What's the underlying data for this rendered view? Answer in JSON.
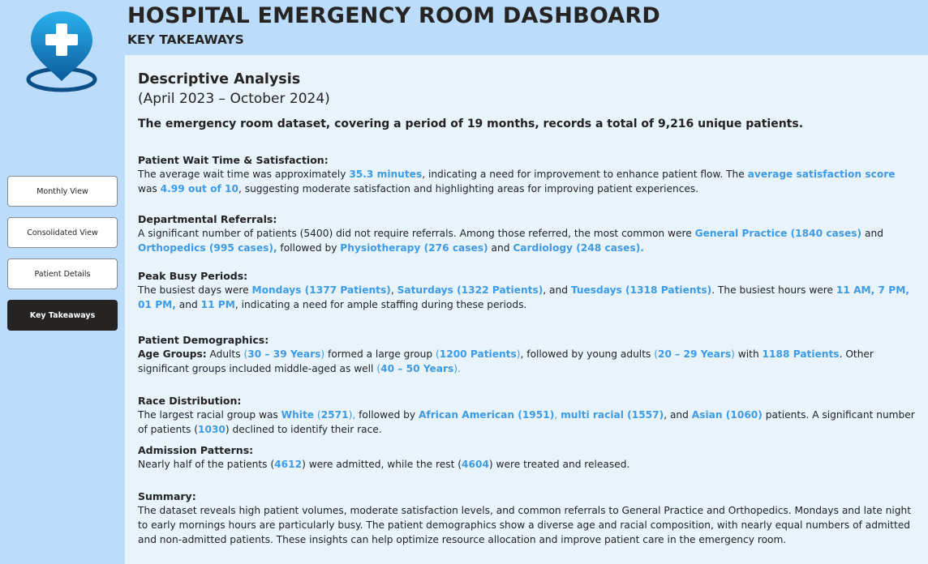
{
  "header": {
    "title": "HOSPITAL EMERGENCY ROOM DASHBOARD",
    "subtitle": "KEY TAKEAWAYS"
  },
  "logo": {
    "icon": "hospital-location-pin-icon",
    "colors": [
      "#1d9fe0",
      "#0a4f88"
    ]
  },
  "sidebar": {
    "items": [
      {
        "label": "Monthly View",
        "active": false
      },
      {
        "label": "Consolidated View",
        "active": false
      },
      {
        "label": "Patient Details",
        "active": false
      },
      {
        "label": "Key Takeaways",
        "active": true
      }
    ]
  },
  "colors": {
    "accent": "#3d9be9",
    "active_button": "#252423",
    "panel": "#e8f3fc",
    "background": "#bcdcfb"
  },
  "content": {
    "title": "Descriptive Analysis",
    "period": "(April 2023 – October 2024)",
    "lead": "The emergency room dataset, covering a period of 19 months, records a total of 9,216 unique patients.",
    "wait": {
      "heading": "Patient Wait Time & Satisfaction:",
      "t1": "The average wait time was approximately ",
      "h1": "35.3 minutes",
      "t2": ", indicating a need for improvement to enhance patient flow. The ",
      "h2": "average satisfaction score",
      "t3": " was ",
      "h3": "4.99 out of 10",
      "t4": ", suggesting moderate satisfaction and highlighting areas for improving patient experiences."
    },
    "referrals": {
      "heading": "Departmental Referrals:",
      "t1": "A significant number of patients (5400) did not require referrals. Among those referred, the most common were ",
      "h1": "General Practice (1840 cases)",
      "t2": " and ",
      "h2": "Orthopedics (995 cases),",
      "t3": " followed by ",
      "h3": "Physiotherapy (276 cases)",
      "t4": " and ",
      "h4": "Cardiology (248 cases).",
      "t5": ""
    },
    "peak": {
      "heading": "Peak Busy Periods:",
      "t1": "The busiest days were ",
      "h1": "Mondays (1377 Patients)",
      "t2": ", ",
      "h2": "Saturdays (1322 Patients)",
      "t3": ", and ",
      "h3": "Tuesdays (1318 Patients)",
      "t4": ". The busiest hours were ",
      "h4": "11 AM, 7 PM, 01 PM,",
      "t5": " and ",
      "h5": "11 PM",
      "t6": ", indicating a need for ample staffing during these periods."
    },
    "demographics": {
      "heading": "Patient Demographics:",
      "label": "Age Groups:",
      "t1": " Adults ",
      "n1": "(",
      "h1": "30 – 39 Years",
      "n2": ")",
      "t2": " formed a large group ",
      "n3": "(",
      "h2": "1200 Patients",
      "n4": ")",
      "t3": ", followed by young adults ",
      "n5": "(",
      "h3": "20 – 29 Years",
      "n6": ")",
      "t4": " with ",
      "h4": "1188 Patients",
      "t5": ". Other significant groups included middle-aged as well ",
      "n7": "(",
      "h5": "40 – 50 Years",
      "n8": ").",
      "t6": ""
    },
    "race": {
      "heading": "Race Distribution:",
      "t1": "The largest racial group was ",
      "h1": "White",
      "n1": " (",
      "h2": "2571",
      "n2": "),",
      "t2": " followed by ",
      "h3": "African American (1951)",
      "n3": ", ",
      "h4": "multi racial (1557)",
      "t3": ", and ",
      "h5": "Asian (1060)",
      "t4": " patients. A significant number of patients (",
      "h6": "1030",
      "t5": ") declined to identify their race."
    },
    "admission": {
      "heading": "Admission Patterns:",
      "t1": "Nearly half of the patients (",
      "h1": "4612",
      "t2": ") were admitted, while the rest (",
      "h2": "4604",
      "t3": ") were treated and released."
    },
    "summary": {
      "heading": "Summary:",
      "text": "The dataset reveals high patient volumes, moderate satisfaction levels, and common referrals to General Practice and Orthopedics. Mondays and late night to early mornings hours are particularly busy. The patient demographics show a diverse age and racial composition, with nearly equal numbers of admitted and non-admitted patients. These insights can help optimize resource allocation and improve patient care in the emergency room."
    }
  }
}
